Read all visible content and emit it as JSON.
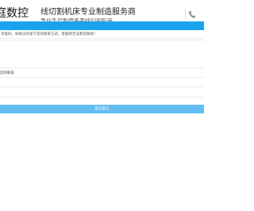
{
  "header": {
    "brand": "庭数控",
    "tagline": "线切割机床专业制造服务商",
    "tagline_sub": "专业生产制造各类线切割机床"
  },
  "form": {
    "notice": "亲爱的，如果没有留下您的联系方式，客服将无法和您联系！",
    "contact_label": "您的联系",
    "submit_label": "提交留言"
  },
  "colors": {
    "accent": "#1aa3ec",
    "button": "#64bdf2"
  },
  "icons": {
    "phone": "phone-icon"
  }
}
